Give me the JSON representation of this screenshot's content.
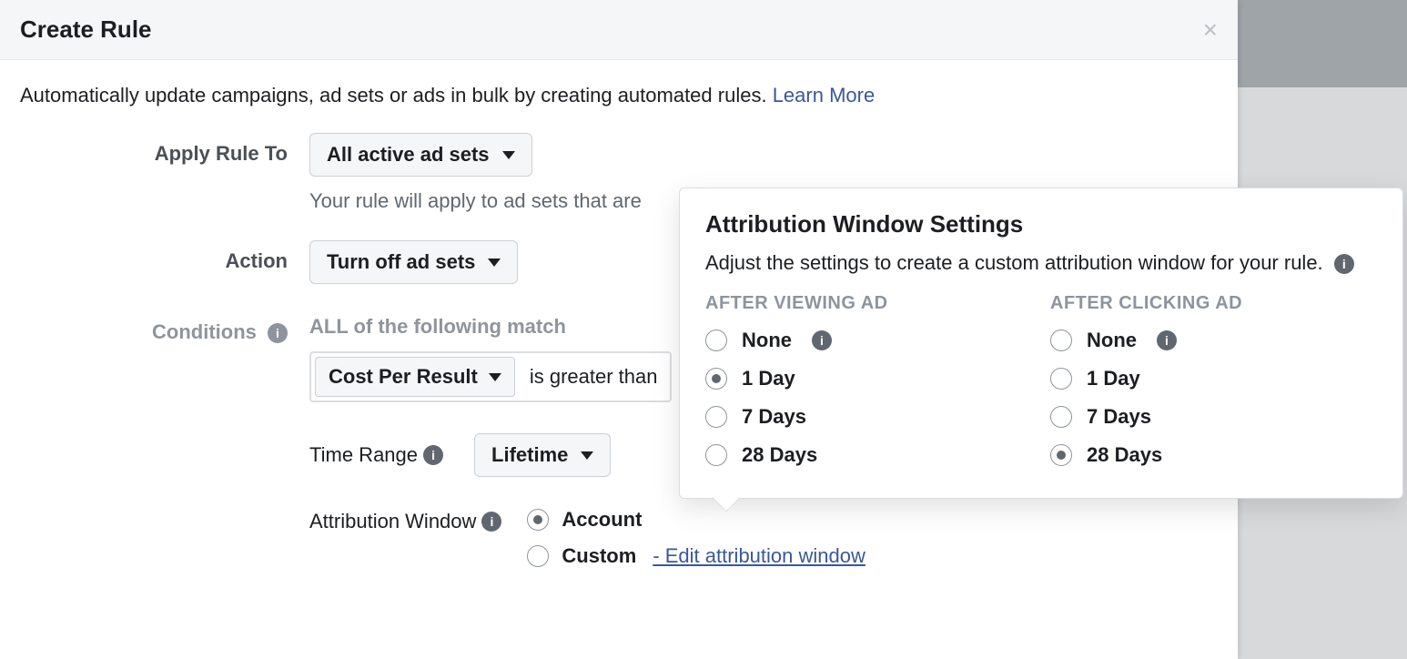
{
  "modal": {
    "title": "Create Rule",
    "intro_text": "Automatically update campaigns, ad sets or ads in bulk by creating automated rules. ",
    "learn_more": "Learn More"
  },
  "apply": {
    "label": "Apply Rule To",
    "value": "All active ad sets",
    "helper": "Your rule will apply to ad sets that are "
  },
  "action": {
    "label": "Action",
    "value": "Turn off ad sets"
  },
  "conditions": {
    "label": "Conditions",
    "all_match": "ALL of the following match",
    "metric": "Cost Per Result",
    "operator": "is greater than"
  },
  "time_range": {
    "label": "Time Range",
    "value": "Lifetime"
  },
  "attribution_window": {
    "label": "Attribution Window",
    "options": {
      "account_default": "Account",
      "custom": "Custom",
      "edit_link": "- Edit attribution window"
    },
    "selected": "account_default"
  },
  "popover": {
    "title": "Attribution Window Settings",
    "description": "Adjust the settings to create a custom attribution window for your rule. ",
    "view": {
      "heading": "AFTER VIEWING AD",
      "options": [
        "None",
        "1 Day",
        "7 Days",
        "28 Days"
      ],
      "selected": "1 Day"
    },
    "click": {
      "heading": "AFTER CLICKING AD",
      "options": [
        "None",
        "1 Day",
        "7 Days",
        "28 Days"
      ],
      "selected": "28 Days"
    }
  }
}
